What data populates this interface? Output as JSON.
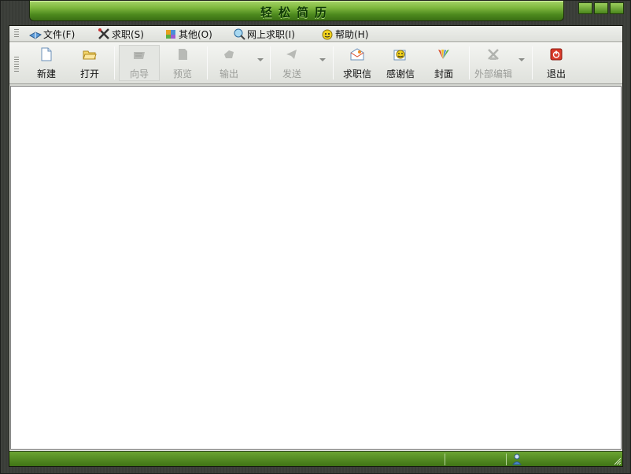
{
  "window": {
    "title": "轻松简历"
  },
  "menu": [
    {
      "label": "文件(F)",
      "icon": "book-icon"
    },
    {
      "label": "求职(S)",
      "icon": "cross-tools-icon"
    },
    {
      "label": "其他(O)",
      "icon": "colorful-cube-icon"
    },
    {
      "label": "网上求职(I)",
      "icon": "globe-search-icon"
    },
    {
      "label": "帮助(H)",
      "icon": "smiley-help-icon"
    }
  ],
  "toolbar": [
    {
      "label": "新建",
      "icon": "new-document-icon",
      "enabled": true
    },
    {
      "label": "打开",
      "icon": "open-folder-icon",
      "enabled": true
    },
    {
      "label": "向导",
      "icon": "wizard-icon",
      "enabled": false
    },
    {
      "label": "预览",
      "icon": "preview-icon",
      "enabled": false
    },
    {
      "label": "输出",
      "icon": "export-icon",
      "enabled": false,
      "dropdown": true
    },
    {
      "label": "发送",
      "icon": "send-icon",
      "enabled": false,
      "dropdown": true
    },
    {
      "label": "求职信",
      "icon": "envelope-icon",
      "enabled": true
    },
    {
      "label": "感谢信",
      "icon": "thank-smiley-icon",
      "enabled": true
    },
    {
      "label": "封面",
      "icon": "cover-icon",
      "enabled": true
    },
    {
      "label": "外部编辑",
      "icon": "external-edit-icon",
      "enabled": false,
      "dropdown": true
    },
    {
      "label": "退出",
      "icon": "exit-icon",
      "enabled": true
    }
  ],
  "colors": {
    "accent": "#5a9424",
    "title_text": "#0f3a06",
    "disabled_text": "#9a9c98"
  }
}
